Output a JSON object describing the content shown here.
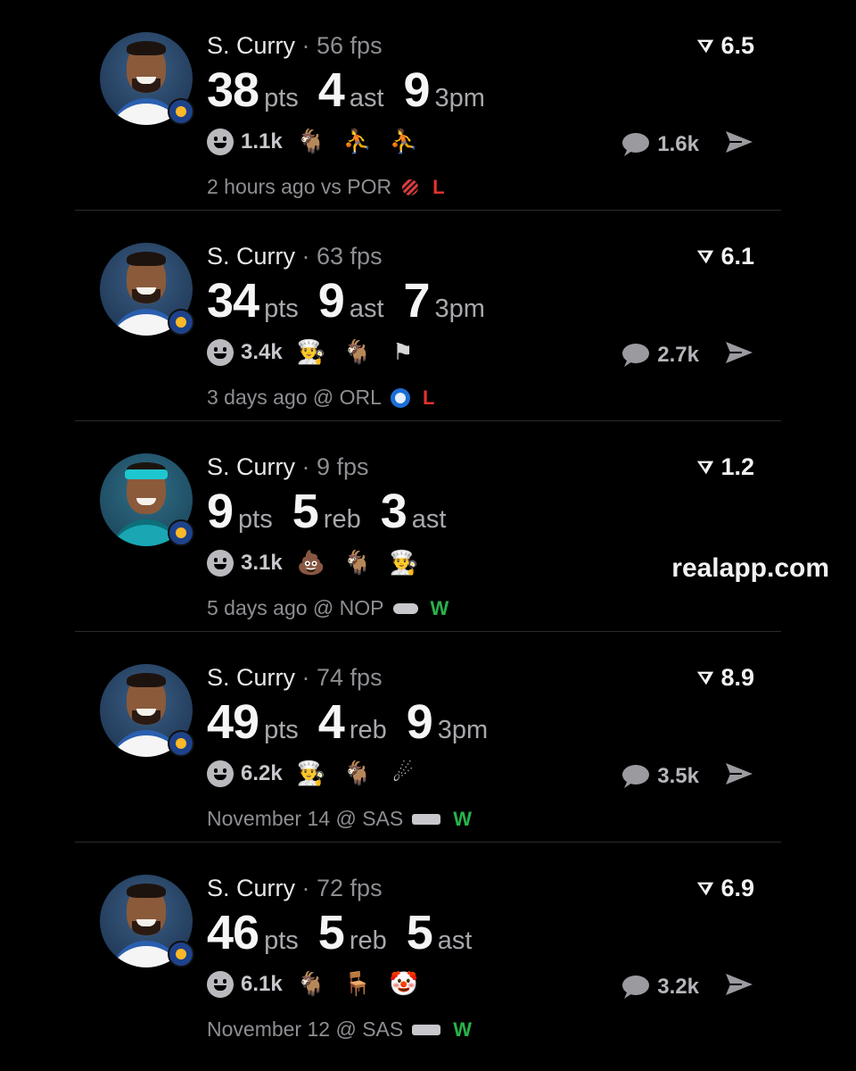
{
  "colors": {
    "background": "#000000",
    "loss": "#e5322d",
    "win": "#28b34a",
    "muted_text": "#8e8e93"
  },
  "site": "realapp.com",
  "posts": [
    {
      "name": "S. Curry",
      "fps": "· 56 fps",
      "rating": "6.5",
      "stats": [
        {
          "value": "38",
          "unit": "pts"
        },
        {
          "value": "4",
          "unit": "ast"
        },
        {
          "value": "9",
          "unit": "3pm"
        }
      ],
      "reaction_count": "1.1k",
      "emojis": [
        "goat-icon",
        "player-sticker-icon",
        "player-sticker-icon"
      ],
      "emoji_glyphs": [
        "🐐",
        "⛹",
        "⛹"
      ],
      "comment_count": "1.6k",
      "meta": "2 hours ago vs POR",
      "opponent_logo": "por",
      "result": "L"
    },
    {
      "name": "S. Curry",
      "fps": "· 63 fps",
      "rating": "6.1",
      "stats": [
        {
          "value": "34",
          "unit": "pts"
        },
        {
          "value": "9",
          "unit": "ast"
        },
        {
          "value": "7",
          "unit": "3pm"
        }
      ],
      "reaction_count": "3.4k",
      "emojis": [
        "chef-icon",
        "goat-icon",
        "philippines-flag-icon"
      ],
      "emoji_glyphs": [
        "👨‍🍳",
        "🐐",
        "⚑"
      ],
      "comment_count": "2.7k",
      "meta": "3 days ago @ ORL",
      "opponent_logo": "orl",
      "result": "L"
    },
    {
      "name": "S. Curry",
      "fps": "· 9 fps",
      "rating": "1.2",
      "stats": [
        {
          "value": "9",
          "unit": "pts"
        },
        {
          "value": "5",
          "unit": "reb"
        },
        {
          "value": "3",
          "unit": "ast"
        }
      ],
      "reaction_count": "3.1k",
      "emojis": [
        "poop-icon",
        "goat-icon",
        "chef-icon"
      ],
      "emoji_glyphs": [
        "💩",
        "🐐",
        "👨‍🍳"
      ],
      "comment_count": "",
      "meta": "5 days ago @ NOP",
      "opponent_logo": "nop",
      "result": "W"
    },
    {
      "name": "S. Curry",
      "fps": "· 74 fps",
      "rating": "8.9",
      "stats": [
        {
          "value": "49",
          "unit": "pts"
        },
        {
          "value": "4",
          "unit": "reb"
        },
        {
          "value": "9",
          "unit": "3pm"
        }
      ],
      "reaction_count": "6.2k",
      "emojis": [
        "chef-icon",
        "goat-icon",
        "comet-icon"
      ],
      "emoji_glyphs": [
        "👨‍🍳",
        "🐐",
        "☄"
      ],
      "comment_count": "3.5k",
      "meta": "November 14 @ SAS",
      "opponent_logo": "sas",
      "result": "W"
    },
    {
      "name": "S. Curry",
      "fps": "· 72 fps",
      "rating": "6.9",
      "stats": [
        {
          "value": "46",
          "unit": "pts"
        },
        {
          "value": "5",
          "unit": "reb"
        },
        {
          "value": "5",
          "unit": "ast"
        }
      ],
      "reaction_count": "6.1k",
      "emojis": [
        "goat-icon",
        "chair-icon",
        "clown-icon"
      ],
      "emoji_glyphs": [
        "🐐",
        "🪑",
        "🤡"
      ],
      "comment_count": "3.2k",
      "meta": "November 12 @ SAS",
      "opponent_logo": "sas",
      "result": "W"
    }
  ]
}
